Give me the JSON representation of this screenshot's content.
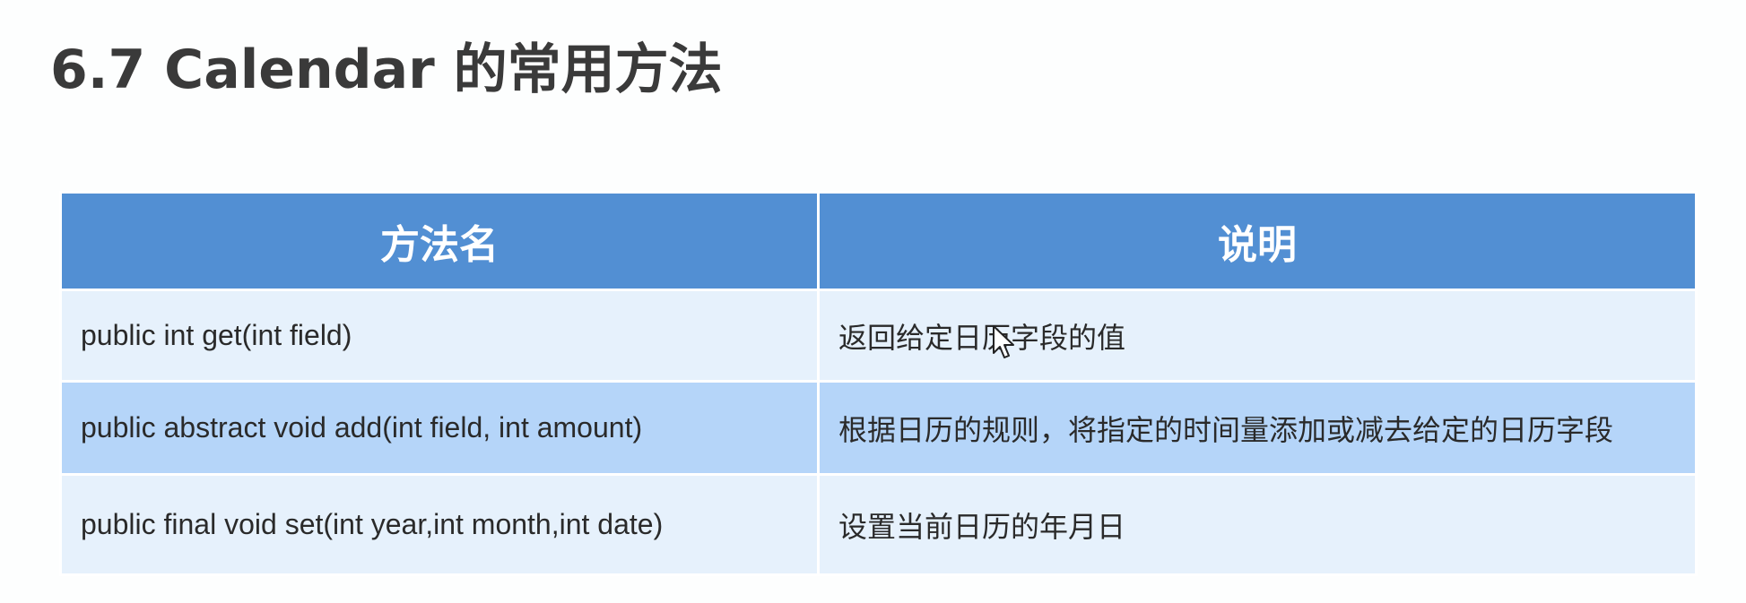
{
  "title": "6.7 Calendar 的常用方法",
  "table": {
    "headers": {
      "method": "方法名",
      "description": "说明"
    },
    "rows": [
      {
        "method": "public int get(int field)",
        "description": "返回给定日历字段的值"
      },
      {
        "method": "public abstract void add(int field, int amount)",
        "description": "根据日历的规则，将指定的时间量添加或减去给定的日历字段"
      },
      {
        "method": "public final void set(int year,int month,int date)",
        "description": "设置当前日历的年月日"
      }
    ]
  },
  "colors": {
    "header": "#528fd3",
    "row_light": "#e6f1fc",
    "row_dark": "#b5d5f9",
    "title_text": "#3a3a3a"
  },
  "icons": {
    "cursor": "mouse-pointer-icon"
  }
}
